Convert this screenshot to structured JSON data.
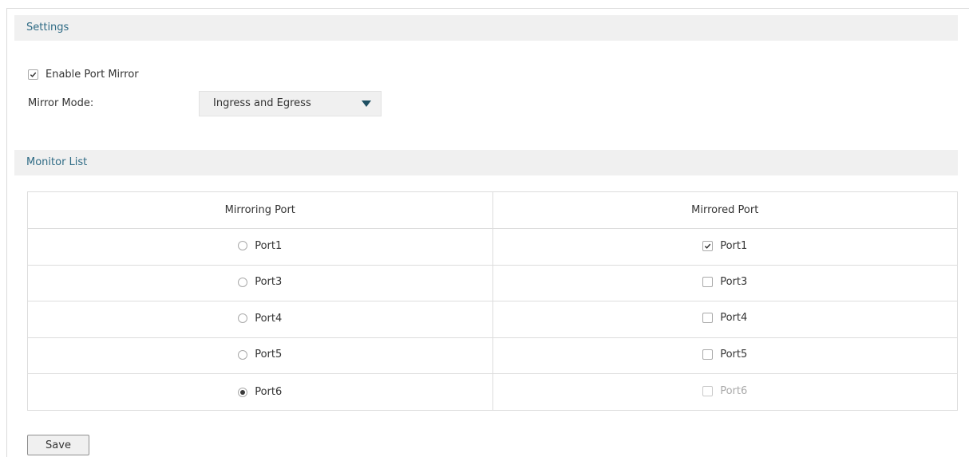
{
  "settings": {
    "title": "Settings",
    "enable_port_mirror": {
      "label": "Enable Port Mirror",
      "checked": true
    },
    "mirror_mode": {
      "label": "Mirror Mode:",
      "value": "Ingress and Egress"
    }
  },
  "monitor_list": {
    "title": "Monitor List",
    "columns": [
      "Mirroring Port",
      "Mirrored Port"
    ],
    "rows": [
      {
        "mirroring": {
          "label": "Port1",
          "selected": false
        },
        "mirrored": {
          "label": "Port1",
          "checked": true,
          "disabled": false
        }
      },
      {
        "mirroring": {
          "label": "Port3",
          "selected": false
        },
        "mirrored": {
          "label": "Port3",
          "checked": false,
          "disabled": false
        }
      },
      {
        "mirroring": {
          "label": "Port4",
          "selected": false
        },
        "mirrored": {
          "label": "Port4",
          "checked": false,
          "disabled": false
        }
      },
      {
        "mirroring": {
          "label": "Port5",
          "selected": false
        },
        "mirrored": {
          "label": "Port5",
          "checked": false,
          "disabled": false
        }
      },
      {
        "mirroring": {
          "label": "Port6",
          "selected": true
        },
        "mirrored": {
          "label": "Port6",
          "checked": false,
          "disabled": true
        }
      }
    ]
  },
  "save_label": "Save"
}
